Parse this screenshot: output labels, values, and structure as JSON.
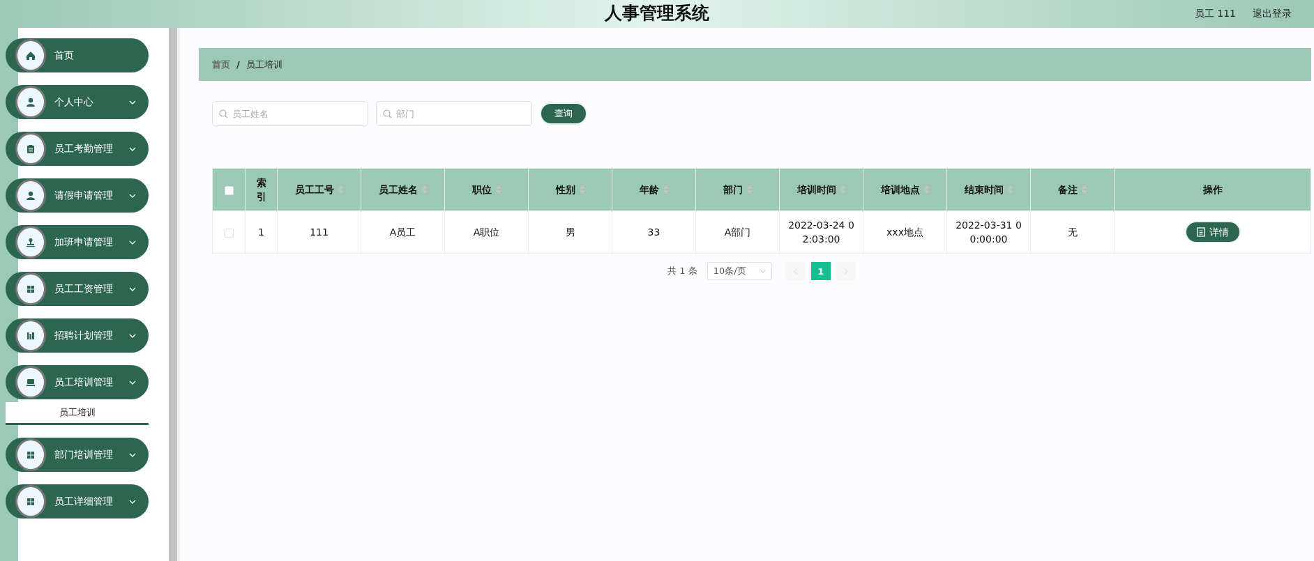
{
  "header": {
    "title": "人事管理系统",
    "user": "员工 111",
    "logout": "退出登录"
  },
  "sidebar": {
    "items": [
      {
        "label": "首页",
        "kind": "link"
      },
      {
        "label": "个人中心",
        "kind": "group"
      },
      {
        "label": "员工考勤管理",
        "kind": "group"
      },
      {
        "label": "请假申请管理",
        "kind": "group"
      },
      {
        "label": "加班申请管理",
        "kind": "group"
      },
      {
        "label": "员工工资管理",
        "kind": "group"
      },
      {
        "label": "招聘计划管理",
        "kind": "group"
      },
      {
        "label": "员工培训管理",
        "kind": "group",
        "children": [
          {
            "label": "员工培训",
            "selected": true
          }
        ]
      },
      {
        "label": "部门培训管理",
        "kind": "group"
      },
      {
        "label": "员工详细管理",
        "kind": "group"
      }
    ]
  },
  "breadcrumb": {
    "items": [
      "首页",
      "员工培训"
    ],
    "separator": "/"
  },
  "search": {
    "fields": [
      {
        "placeholder": "员工姓名"
      },
      {
        "placeholder": "部门"
      }
    ],
    "button": "查询"
  },
  "table": {
    "select_all": {
      "checked": false
    },
    "columns": [
      {
        "label": "索引",
        "sortable": false
      },
      {
        "label": "员工工号",
        "sortable": true
      },
      {
        "label": "员工姓名",
        "sortable": true
      },
      {
        "label": "职位",
        "sortable": true
      },
      {
        "label": "性别",
        "sortable": true
      },
      {
        "label": "年龄",
        "sortable": true
      },
      {
        "label": "部门",
        "sortable": true
      },
      {
        "label": "培训时间",
        "sortable": true
      },
      {
        "label": "培训地点",
        "sortable": true
      },
      {
        "label": "结束时间",
        "sortable": true
      },
      {
        "label": "备注",
        "sortable": true
      },
      {
        "label": "操作",
        "sortable": false
      }
    ],
    "rows": [
      {
        "checked": false,
        "cells": [
          "1",
          "111",
          "A员工",
          "A职位",
          "男",
          "33",
          "A部门",
          "2022-03-24 02:03:00",
          "xxx地点",
          "2022-03-31 00:00:00",
          "无"
        ],
        "action": "详情"
      }
    ]
  },
  "pagination": {
    "total": "共 1 条",
    "page_size": "10条/页",
    "prev_disabled": true,
    "next_disabled": true,
    "pages": [
      {
        "label": "1",
        "selected": true
      }
    ]
  }
}
